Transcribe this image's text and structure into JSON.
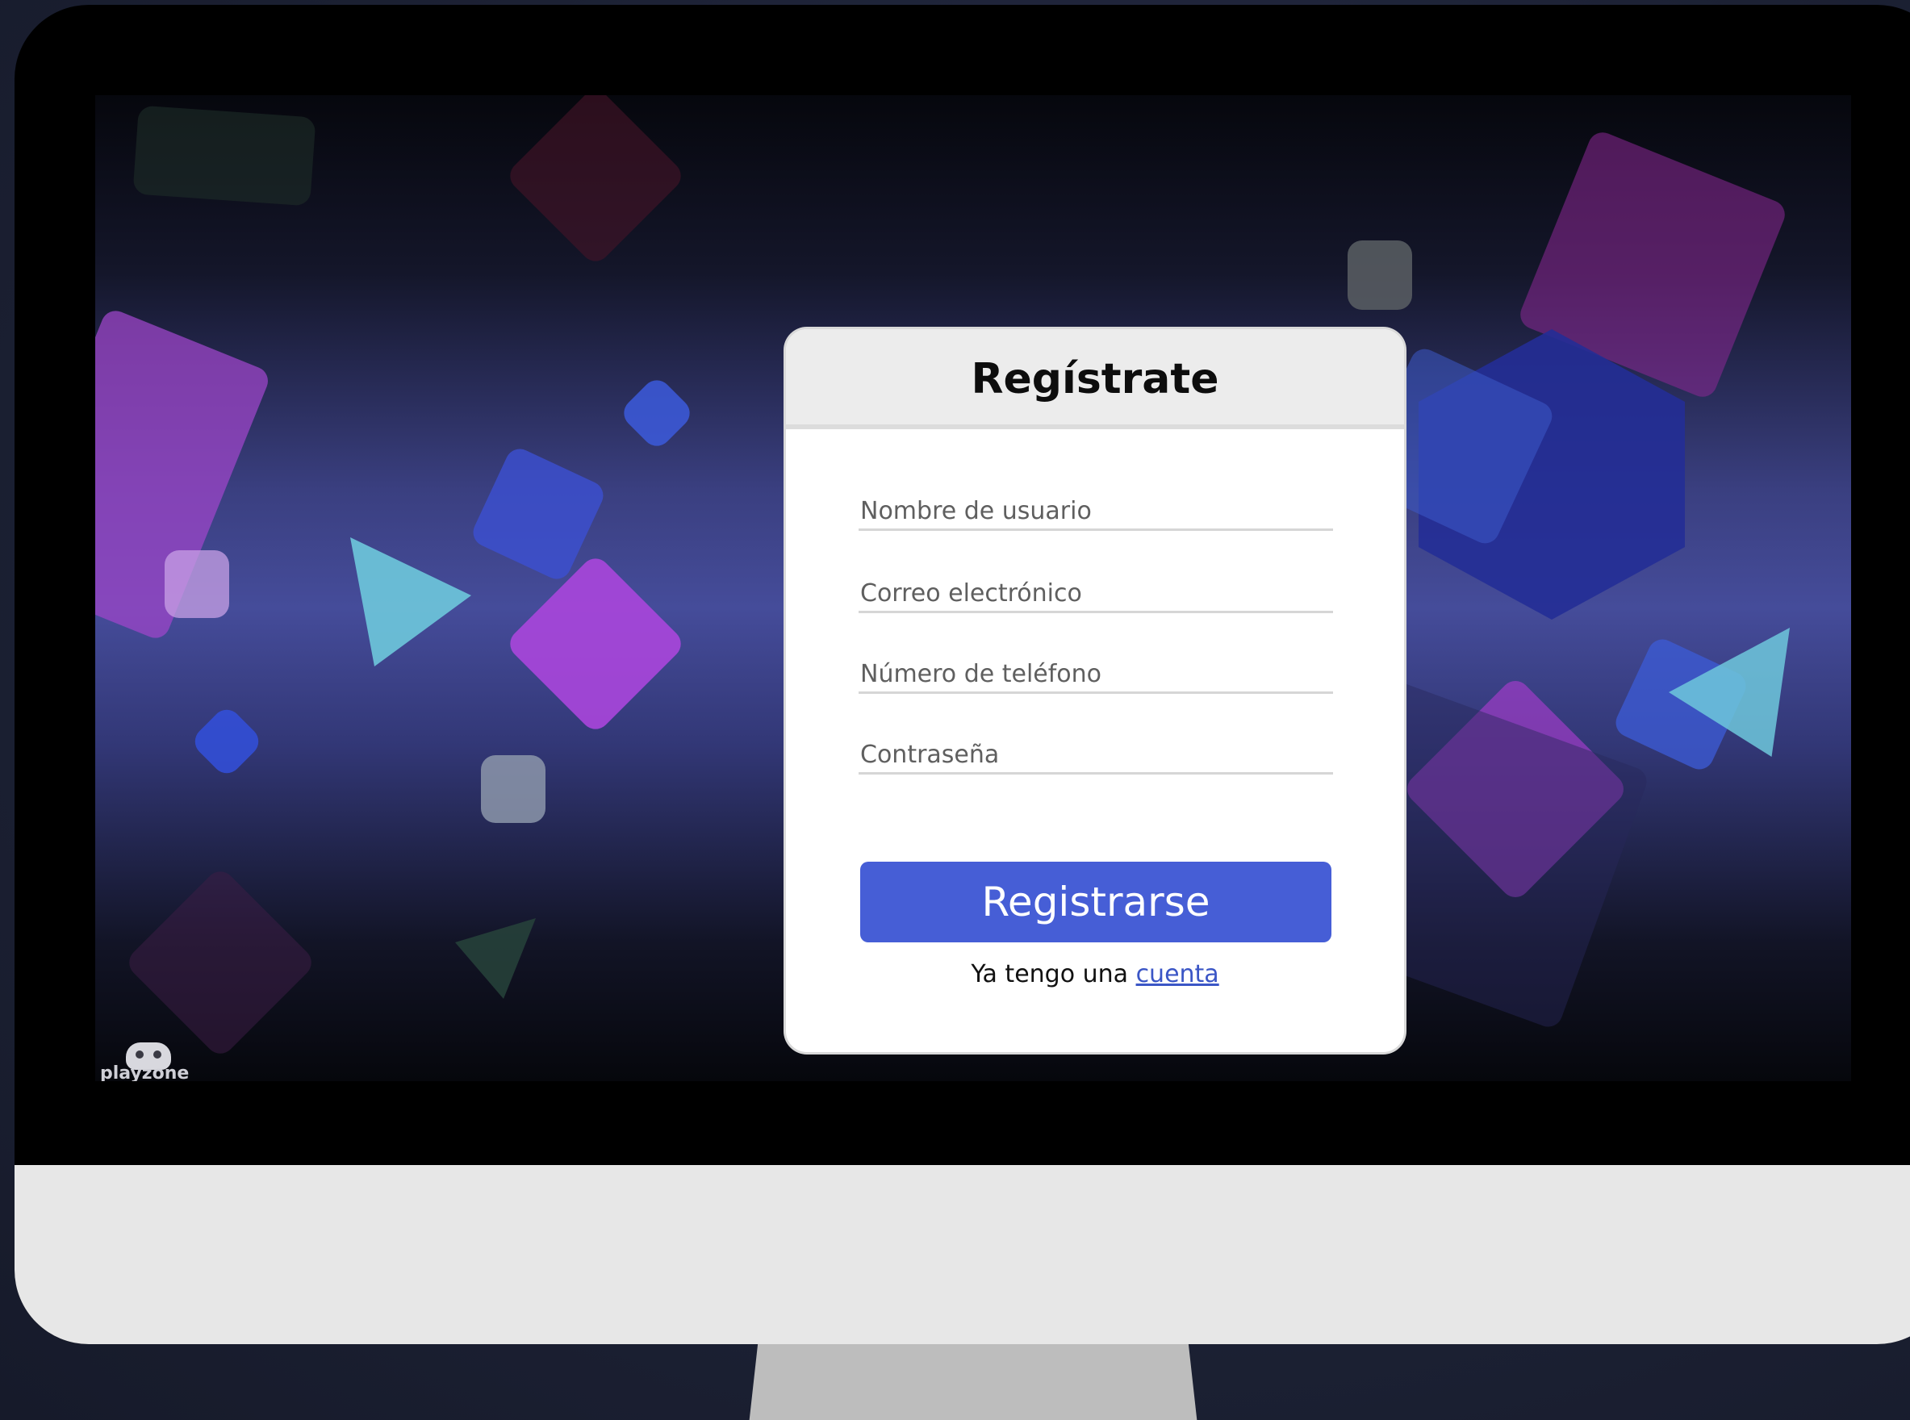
{
  "form": {
    "title": "Regístrate",
    "fields": {
      "username_placeholder": "Nombre de usuario",
      "email_placeholder": "Correo electrónico",
      "phone_placeholder": "Número de teléfono",
      "password_placeholder": "Contraseña"
    },
    "submit_label": "Registrarse",
    "login_prompt": "Ya tengo una",
    "login_link": "cuenta"
  },
  "logo": {
    "icon": "gamepad-icon",
    "text": "playzone"
  },
  "colors": {
    "button": "#465ed6",
    "link": "#3b56c6",
    "card_header": "#ececec",
    "monitor_chin": "#e7e7e7",
    "monitor_stand": "#bdbdbd"
  }
}
